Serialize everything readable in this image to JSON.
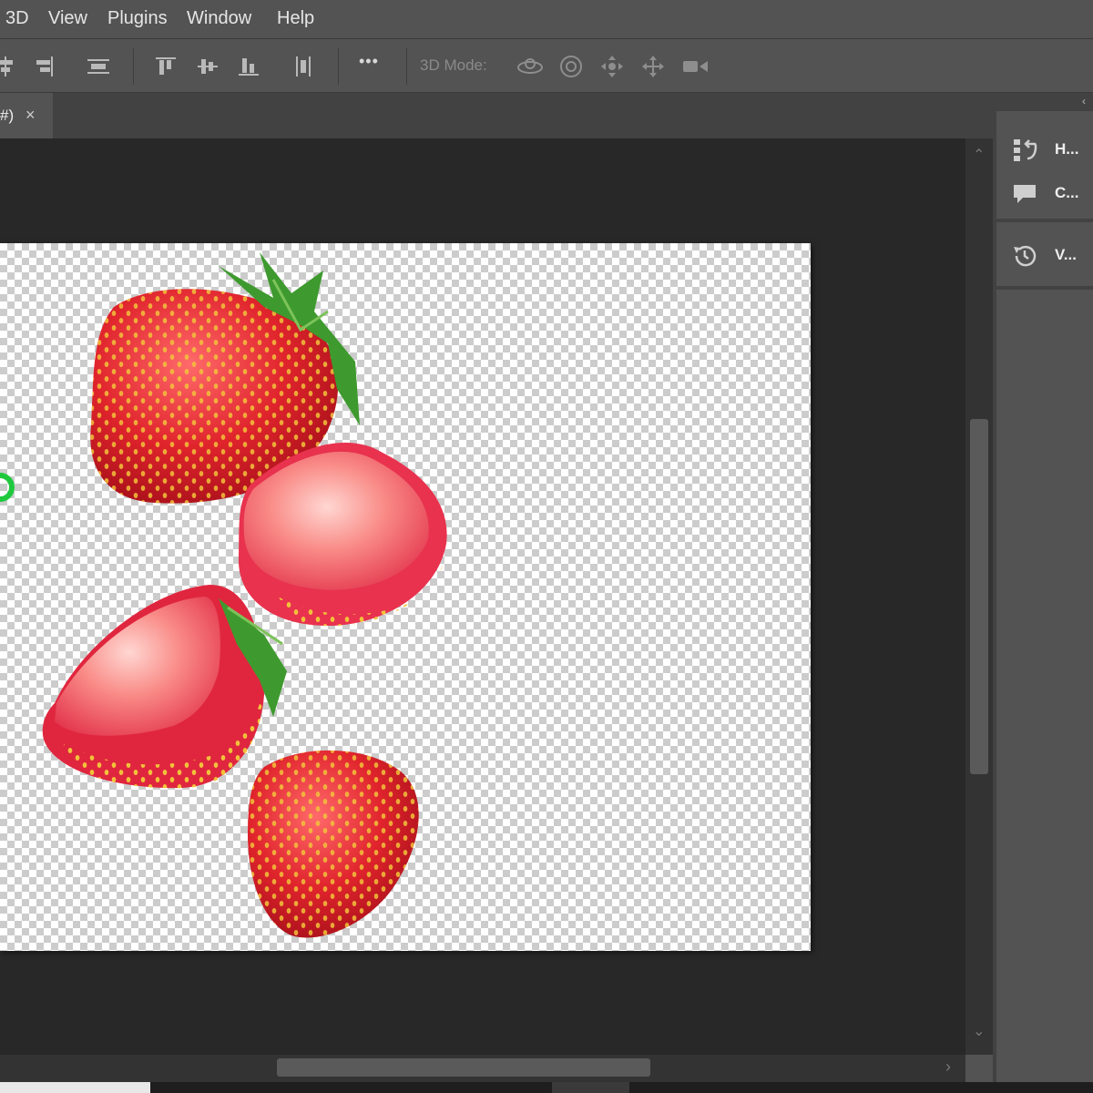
{
  "menu": {
    "items": [
      "3D",
      "View",
      "Plugins",
      "Window",
      "Help"
    ]
  },
  "options_bar": {
    "mode_label": "3D Mode:",
    "more_label": "•••"
  },
  "document_tab": {
    "label": "#)",
    "close": "×"
  },
  "panels": {
    "history_label": "H...",
    "comments_label": "C...",
    "versions_label": "V..."
  },
  "scrollbar_arrows": {
    "up": "⌃",
    "down": "⌄",
    "right": "›"
  },
  "colors": {
    "ui_bg": "#535353",
    "workspace": "#282828",
    "accent_green": "#1fc93e"
  },
  "icons": [
    "align-icon",
    "distribute-icon",
    "more-icon",
    "orbit-3d-icon",
    "roll-3d-icon",
    "pan-3d-icon",
    "slide-3d-icon",
    "scale-3d-icon",
    "history-icon",
    "comments-icon",
    "versions-icon"
  ]
}
